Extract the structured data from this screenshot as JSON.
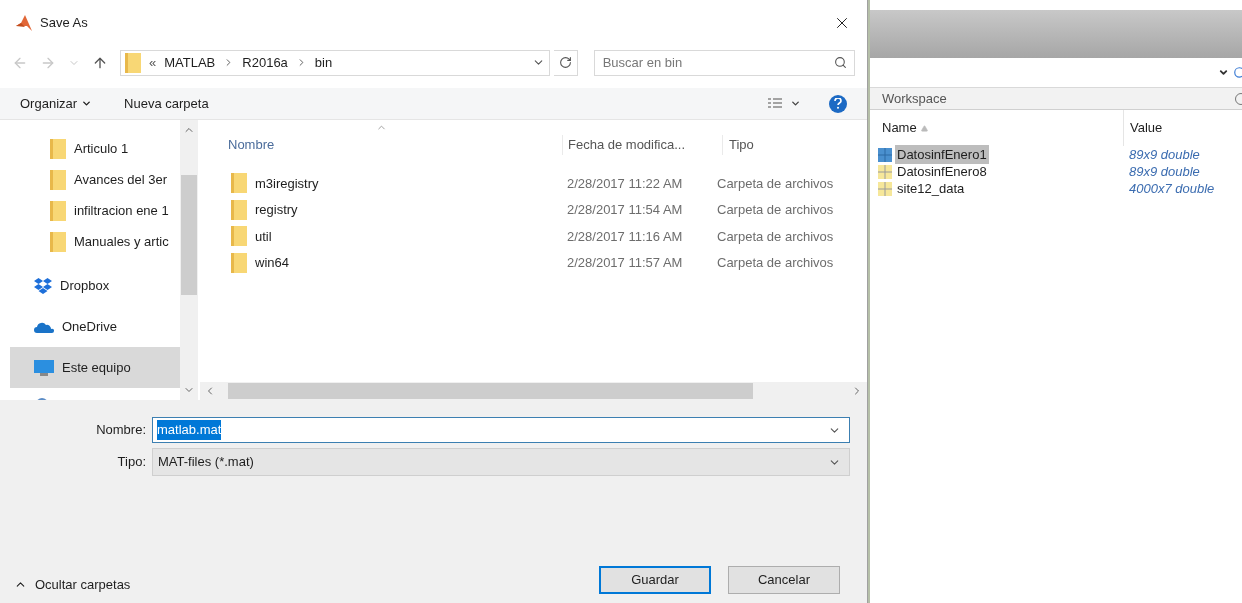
{
  "window": {
    "title": "Save As"
  },
  "address_bar": {
    "overflow": "«",
    "crumbs": [
      "MATLAB",
      "R2016a",
      "bin"
    ]
  },
  "search": {
    "placeholder": "Buscar en bin"
  },
  "toolbar": {
    "organize": "Organizar",
    "new_folder": "Nueva carpeta"
  },
  "nav_pane": {
    "items": [
      {
        "kind": "folder",
        "label": "Articulo 1",
        "selected": false
      },
      {
        "kind": "folder",
        "label": "Avances del 3er",
        "selected": false
      },
      {
        "kind": "folder",
        "label": "infiltracion ene 1",
        "selected": false
      },
      {
        "kind": "folder",
        "label": "Manuales y artic",
        "selected": false
      },
      {
        "kind": "dropbox",
        "label": "Dropbox",
        "selected": false
      },
      {
        "kind": "onedrive",
        "label": "OneDrive",
        "selected": false
      },
      {
        "kind": "computer",
        "label": "Este equipo",
        "selected": true
      }
    ]
  },
  "file_list": {
    "columns": [
      "Nombre",
      "Fecha de modifica...",
      "Tipo"
    ],
    "rows": [
      {
        "name": "m3iregistry",
        "date": "2/28/2017 11:22 AM",
        "type": "Carpeta de archivos"
      },
      {
        "name": "registry",
        "date": "2/28/2017 11:54 AM",
        "type": "Carpeta de archivos"
      },
      {
        "name": "util",
        "date": "2/28/2017 11:16 AM",
        "type": "Carpeta de archivos"
      },
      {
        "name": "win64",
        "date": "2/28/2017 11:57 AM",
        "type": "Carpeta de archivos"
      }
    ]
  },
  "form": {
    "filename_label": "Nombre:",
    "filename": "matlab.mat",
    "filename_highlighted": true,
    "type_label": "Tipo:",
    "type": "MAT-files (*.mat)"
  },
  "footer": {
    "toggle": "Ocultar carpetas",
    "buttons": [
      {
        "label": "Guardar",
        "default": true
      },
      {
        "label": "Cancelar",
        "default": false
      }
    ]
  },
  "workspace": {
    "title": "Workspace",
    "columns": [
      "Name",
      "Value"
    ],
    "rows": [
      {
        "name": "DatosinfEnero1",
        "value": "89x9 double",
        "selected": true
      },
      {
        "name": "DatosinfEnero8",
        "value": "89x9 double",
        "selected": false
      },
      {
        "name": "site12_data",
        "value": "4000x7 double",
        "selected": false
      }
    ]
  }
}
